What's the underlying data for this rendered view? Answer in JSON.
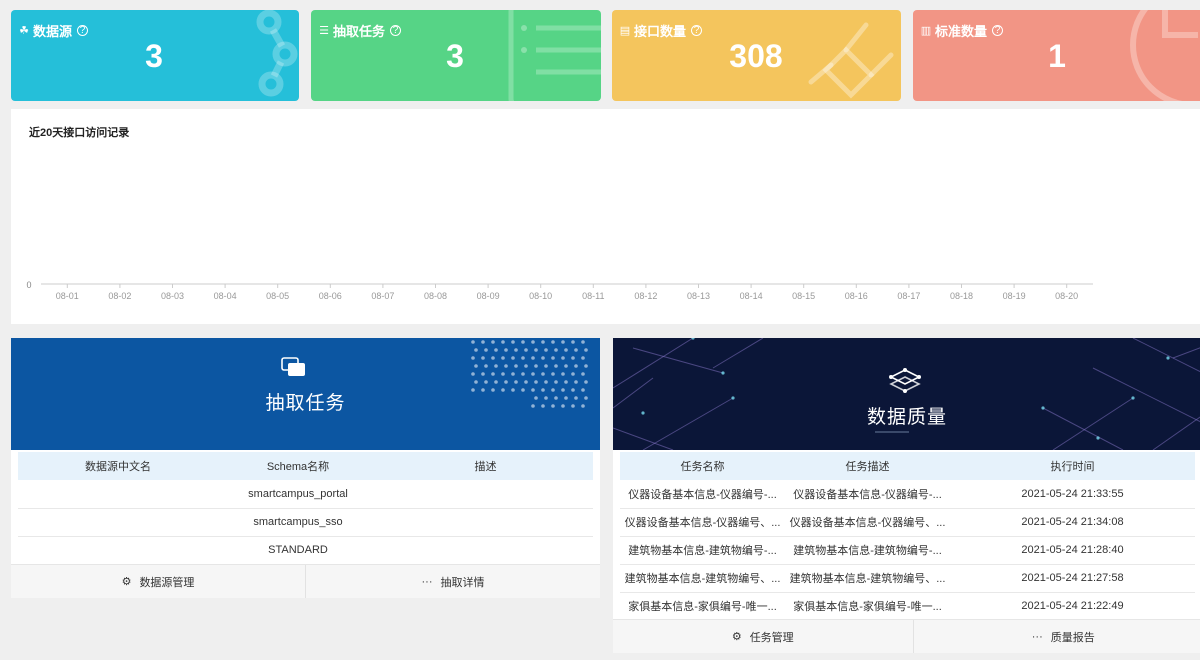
{
  "cards": [
    {
      "id": "card-ds",
      "icon": "cluster-icon",
      "label": "数据源",
      "value": "3",
      "color": "#25bfd9"
    },
    {
      "id": "card-task",
      "icon": "database-icon",
      "label": "抽取任务",
      "value": "3",
      "color": "#56d486"
    },
    {
      "id": "card-api",
      "icon": "printer-icon",
      "label": "接口数量",
      "value": "308",
      "color": "#f4c55d"
    },
    {
      "id": "card-std",
      "icon": "document-icon",
      "label": "标准数量",
      "value": "1",
      "color": "#f29585"
    }
  ],
  "chart": {
    "title": "近20天接口访问记录",
    "chart_data": {
      "type": "line",
      "categories": [
        "08-01",
        "08-02",
        "08-03",
        "08-04",
        "08-05",
        "08-06",
        "08-07",
        "08-08",
        "08-09",
        "08-10",
        "08-11",
        "08-12",
        "08-13",
        "08-14",
        "08-15",
        "08-16",
        "08-17",
        "08-18",
        "08-19",
        "08-20"
      ],
      "values": [
        0,
        0,
        0,
        0,
        0,
        0,
        0,
        0,
        0,
        0,
        0,
        0,
        0,
        0,
        0,
        0,
        0,
        0,
        0,
        0
      ],
      "y_ticks": [
        "0"
      ],
      "ylim": [
        0,
        0
      ]
    }
  },
  "left_panel": {
    "banner_title": "抽取任务",
    "columns": [
      "数据源中文名",
      "Schema名称",
      "描述"
    ],
    "rows": [
      [
        "",
        "smartcampus_portal",
        ""
      ],
      [
        "",
        "smartcampus_sso",
        ""
      ],
      [
        "",
        "STANDARD",
        ""
      ]
    ],
    "footer": [
      {
        "icon": "gear-icon",
        "glyph": "⚙",
        "label": "数据源管理"
      },
      {
        "icon": "more-icon",
        "glyph": "···",
        "label": "抽取详情"
      }
    ]
  },
  "right_panel": {
    "banner_title": "数据质量",
    "columns": [
      "任务名称",
      "任务描述",
      "执行时间"
    ],
    "rows": [
      [
        "仪器设备基本信息-仪器编号-...",
        "仪器设备基本信息-仪器编号-...",
        "2021-05-24 21:33:55"
      ],
      [
        "仪器设备基本信息-仪器编号、...",
        "仪器设备基本信息-仪器编号、...",
        "2021-05-24 21:34:08"
      ],
      [
        "建筑物基本信息-建筑物编号-...",
        "建筑物基本信息-建筑物编号-...",
        "2021-05-24 21:28:40"
      ],
      [
        "建筑物基本信息-建筑物编号、...",
        "建筑物基本信息-建筑物编号、...",
        "2021-05-24 21:27:58"
      ],
      [
        "家俱基本信息-家俱编号-唯一...",
        "家俱基本信息-家俱编号-唯一...",
        "2021-05-24 21:22:49"
      ]
    ],
    "footer": [
      {
        "icon": "gear-icon",
        "glyph": "⚙",
        "label": "任务管理"
      },
      {
        "icon": "more-icon",
        "glyph": "···",
        "label": "质量报告"
      }
    ]
  }
}
